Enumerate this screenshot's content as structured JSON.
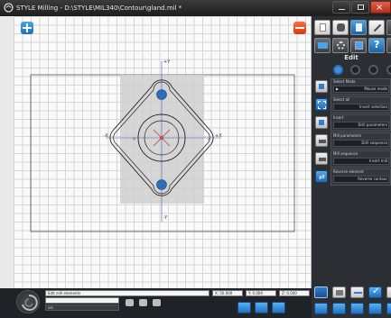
{
  "window": {
    "title": "STYLE Milling - D:\\STYLE\\MIL340\\Contour\\gland.mil *"
  },
  "colors": {
    "accent_blue": "#2a7fd4",
    "accent_orange": "#e8501f",
    "panel_bg": "#2b2e33",
    "selection_gray": "#cfcfcf"
  },
  "canvas": {
    "axes": {
      "plus_y": "+Y",
      "minus_y": "-Y",
      "minus_x": "-X",
      "plus_x": "+X"
    }
  },
  "panel": {
    "section_title": "Edit",
    "rows": [
      {
        "title": "Select Mode",
        "value": "Mouse mode"
      },
      {
        "title": "Select all",
        "value": "Invert selection"
      },
      {
        "title": "Insert",
        "value": "Drill parameters"
      },
      {
        "title": "Mill parameters",
        "value": "Drill sequence"
      },
      {
        "title": "Mill sequence",
        "value": "Insert mill"
      },
      {
        "title": "Reverse element",
        "value": "Reverse contour"
      }
    ]
  },
  "bottom": {
    "status_text": "Edit mill elements",
    "x_value": "X: 50.000",
    "y_value": "Y: 0.000",
    "z_value": "Z: 0.000",
    "field2": "",
    "field3": "sel"
  }
}
